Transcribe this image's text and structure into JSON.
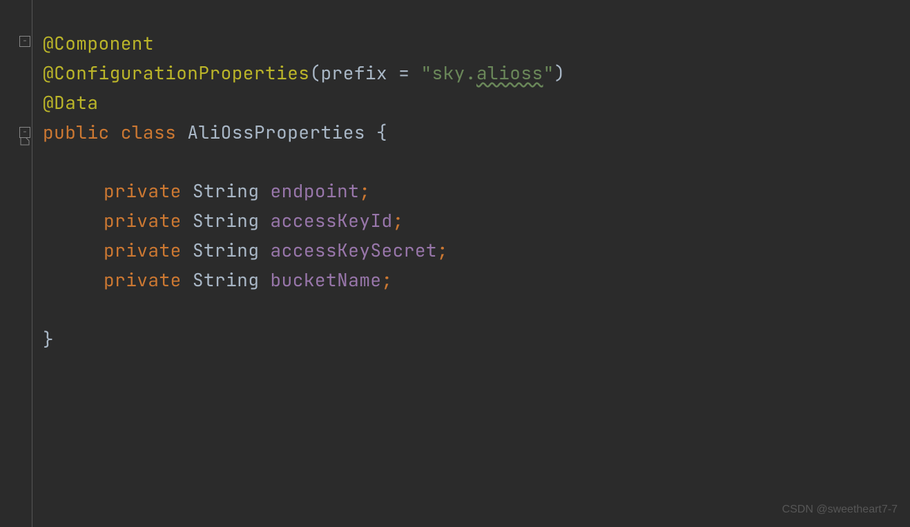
{
  "code": {
    "annotations": {
      "component": "@Component",
      "configProperties": "@ConfigurationProperties",
      "configPrefix": "prefix",
      "configEquals": " = ",
      "configValuePrefix": "\"sky.",
      "configValueUnderlined": "alioss",
      "configValueSuffix": "\"",
      "data": "@Data"
    },
    "declaration": {
      "modifier": "public",
      "classKw": "class",
      "className": "AliOssProperties",
      "openBrace": " {",
      "closeBrace": "}"
    },
    "fields": {
      "privateKw": "private",
      "stringType": "String",
      "endpoint": "endpoint",
      "accessKeyId": "accessKeyId",
      "accessKeySecret": "accessKeySecret",
      "bucketName": "bucketName"
    },
    "punct": {
      "semicolon": ";",
      "openParen": "(",
      "closeParen": ")",
      "space": " "
    }
  },
  "gutter": {
    "foldMinus": "−"
  },
  "watermark": "CSDN @sweetheart7-7"
}
